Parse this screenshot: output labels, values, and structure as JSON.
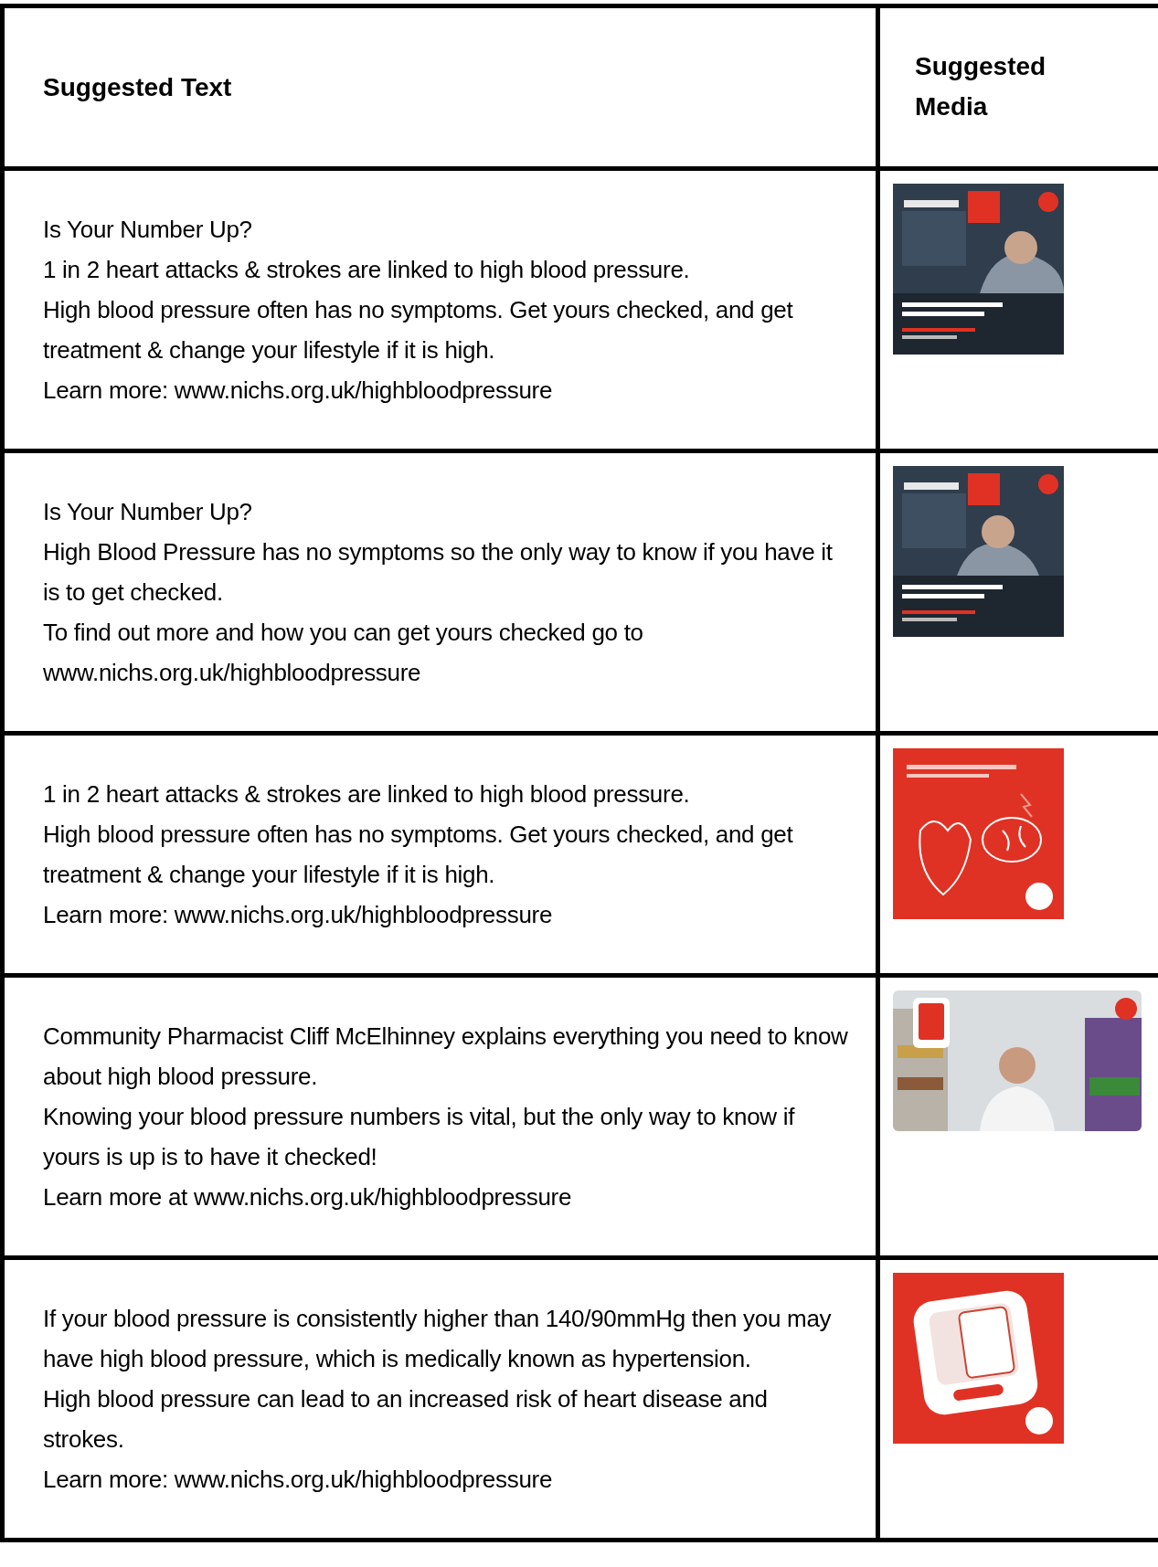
{
  "table": {
    "columns": [
      "Suggested Text",
      "Suggested Media"
    ],
    "rows": [
      {
        "text": [
          "Is Your Number Up?",
          "1 in 2 heart attacks & strokes are linked to high blood pressure.",
          "High blood pressure often has no symptoms. Get yours checked, and get treatment & change your lifestyle if it is high.",
          "Learn more: www.nichs.org.uk/highbloodpressure"
        ],
        "media": {
          "kind": "picture"
        }
      },
      {
        "text": [
          "Is Your Number Up?",
          "High Blood Pressure has no symptoms so the only way to know if you have it is to get checked.",
          "To find out more and how you can get yours checked go to www.nichs.org.uk/highbloodpressure"
        ],
        "media": {
          "kind": "picture"
        }
      },
      {
        "text": [
          "1 in 2 heart attacks & strokes are linked to high blood pressure.",
          "High blood pressure often has no symptoms. Get yours checked, and get treatment & change your lifestyle if it is high.",
          "Learn more: www.nichs.org.uk/highbloodpressure"
        ],
        "media": {
          "kind": "picture"
        }
      },
      {
        "text": [
          "Community Pharmacist Cliff McElhinney explains everything you need to know about high blood pressure.",
          "Knowing your blood pressure numbers is vital, but the only way to know if yours is up is to have it checked!",
          "Learn more at www.nichs.org.uk/highbloodpressure"
        ],
        "media": {
          "kind": "picture"
        }
      },
      {
        "text": [
          "If your blood pressure is consistently higher than 140/90mmHg then you may have high blood pressure, which is medically known as hypertension.",
          "High blood pressure can lead to an increased risk of heart disease and strokes.",
          "Learn more: www.nichs.org.uk/highbloodpressure"
        ],
        "media": {
          "kind": "picture"
        }
      }
    ]
  }
}
